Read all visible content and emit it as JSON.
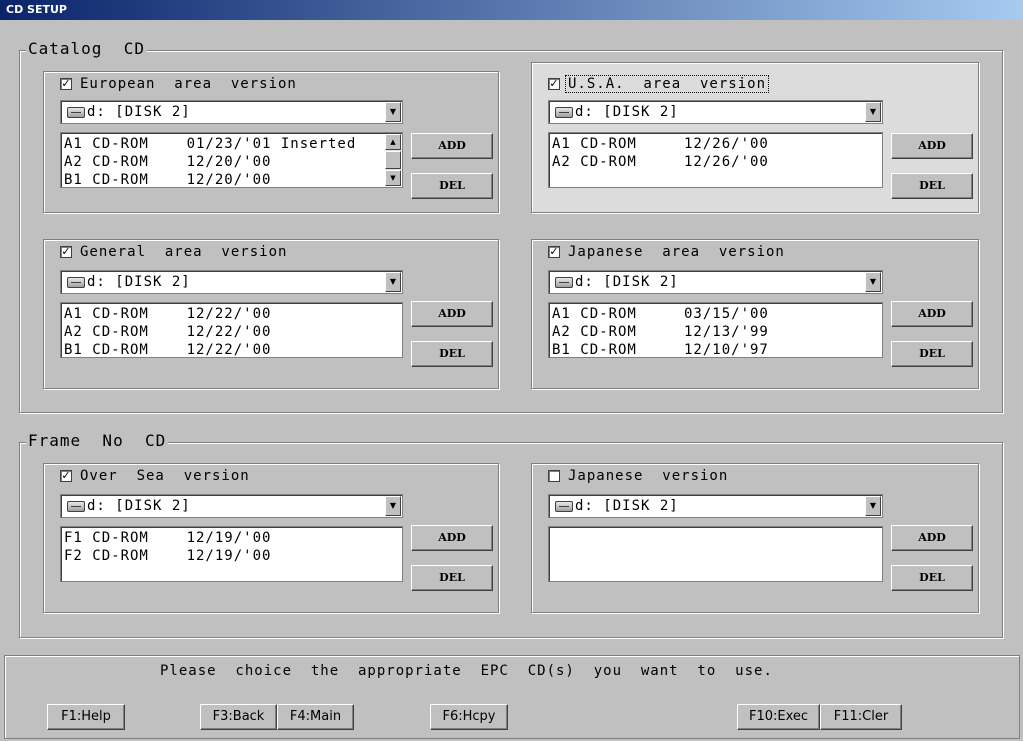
{
  "window": {
    "title": "CD SETUP"
  },
  "catalog": {
    "title": "Catalog  CD",
    "european": {
      "label": "European  area  version",
      "checked": true,
      "drive": "d: [DISK 2]",
      "items": [
        "A1 CD-ROM    01/23/'01 Inserted",
        "A2 CD-ROM    12/20/'00",
        "B1 CD-ROM    12/20/'00"
      ],
      "add_label": "ADD",
      "del_label": "DEL"
    },
    "usa": {
      "label": "U.S.A.  area  version",
      "checked": true,
      "drive": "d: [DISK 2]",
      "items": [
        "A1 CD-ROM     12/26/'00",
        "A2 CD-ROM     12/26/'00"
      ],
      "add_label": "ADD",
      "del_label": "DEL"
    },
    "general": {
      "label": "General  area  version",
      "checked": true,
      "drive": "d: [DISK 2]",
      "items": [
        "A1 CD-ROM    12/22/'00",
        "A2 CD-ROM    12/22/'00",
        "B1 CD-ROM    12/22/'00"
      ],
      "add_label": "ADD",
      "del_label": "DEL"
    },
    "japanese": {
      "label": "Japanese  area  version",
      "checked": true,
      "drive": "d: [DISK 2]",
      "items": [
        "A1 CD-ROM     03/15/'00",
        "A2 CD-ROM     12/13/'99",
        "B1 CD-ROM     12/10/'97"
      ],
      "add_label": "ADD",
      "del_label": "DEL"
    }
  },
  "frame": {
    "title": "Frame  No  CD",
    "oversea": {
      "label": "Over  Sea  version",
      "checked": true,
      "drive": "d: [DISK 2]",
      "items": [
        "F1 CD-ROM    12/19/'00",
        "F2 CD-ROM    12/19/'00"
      ],
      "add_label": "ADD",
      "del_label": "DEL"
    },
    "japanese": {
      "label": "Japanese  version",
      "checked": false,
      "drive": "d: [DISK 2]",
      "items": [],
      "add_label": "ADD",
      "del_label": "DEL"
    }
  },
  "status": {
    "message": "Please  choice  the  appropriate  EPC  CD(s)  you  want  to  use."
  },
  "fkeys": {
    "help": "F1:Help",
    "back": "F3:Back",
    "main": "F4:Main",
    "hcpy": "F6:Hcpy",
    "exec": "F10:Exec",
    "cler": "F11:Cler"
  },
  "icons": {
    "drive": "cd-drive-icon",
    "combo_arrow": "chevron-down-icon",
    "check": "checkmark-icon"
  }
}
